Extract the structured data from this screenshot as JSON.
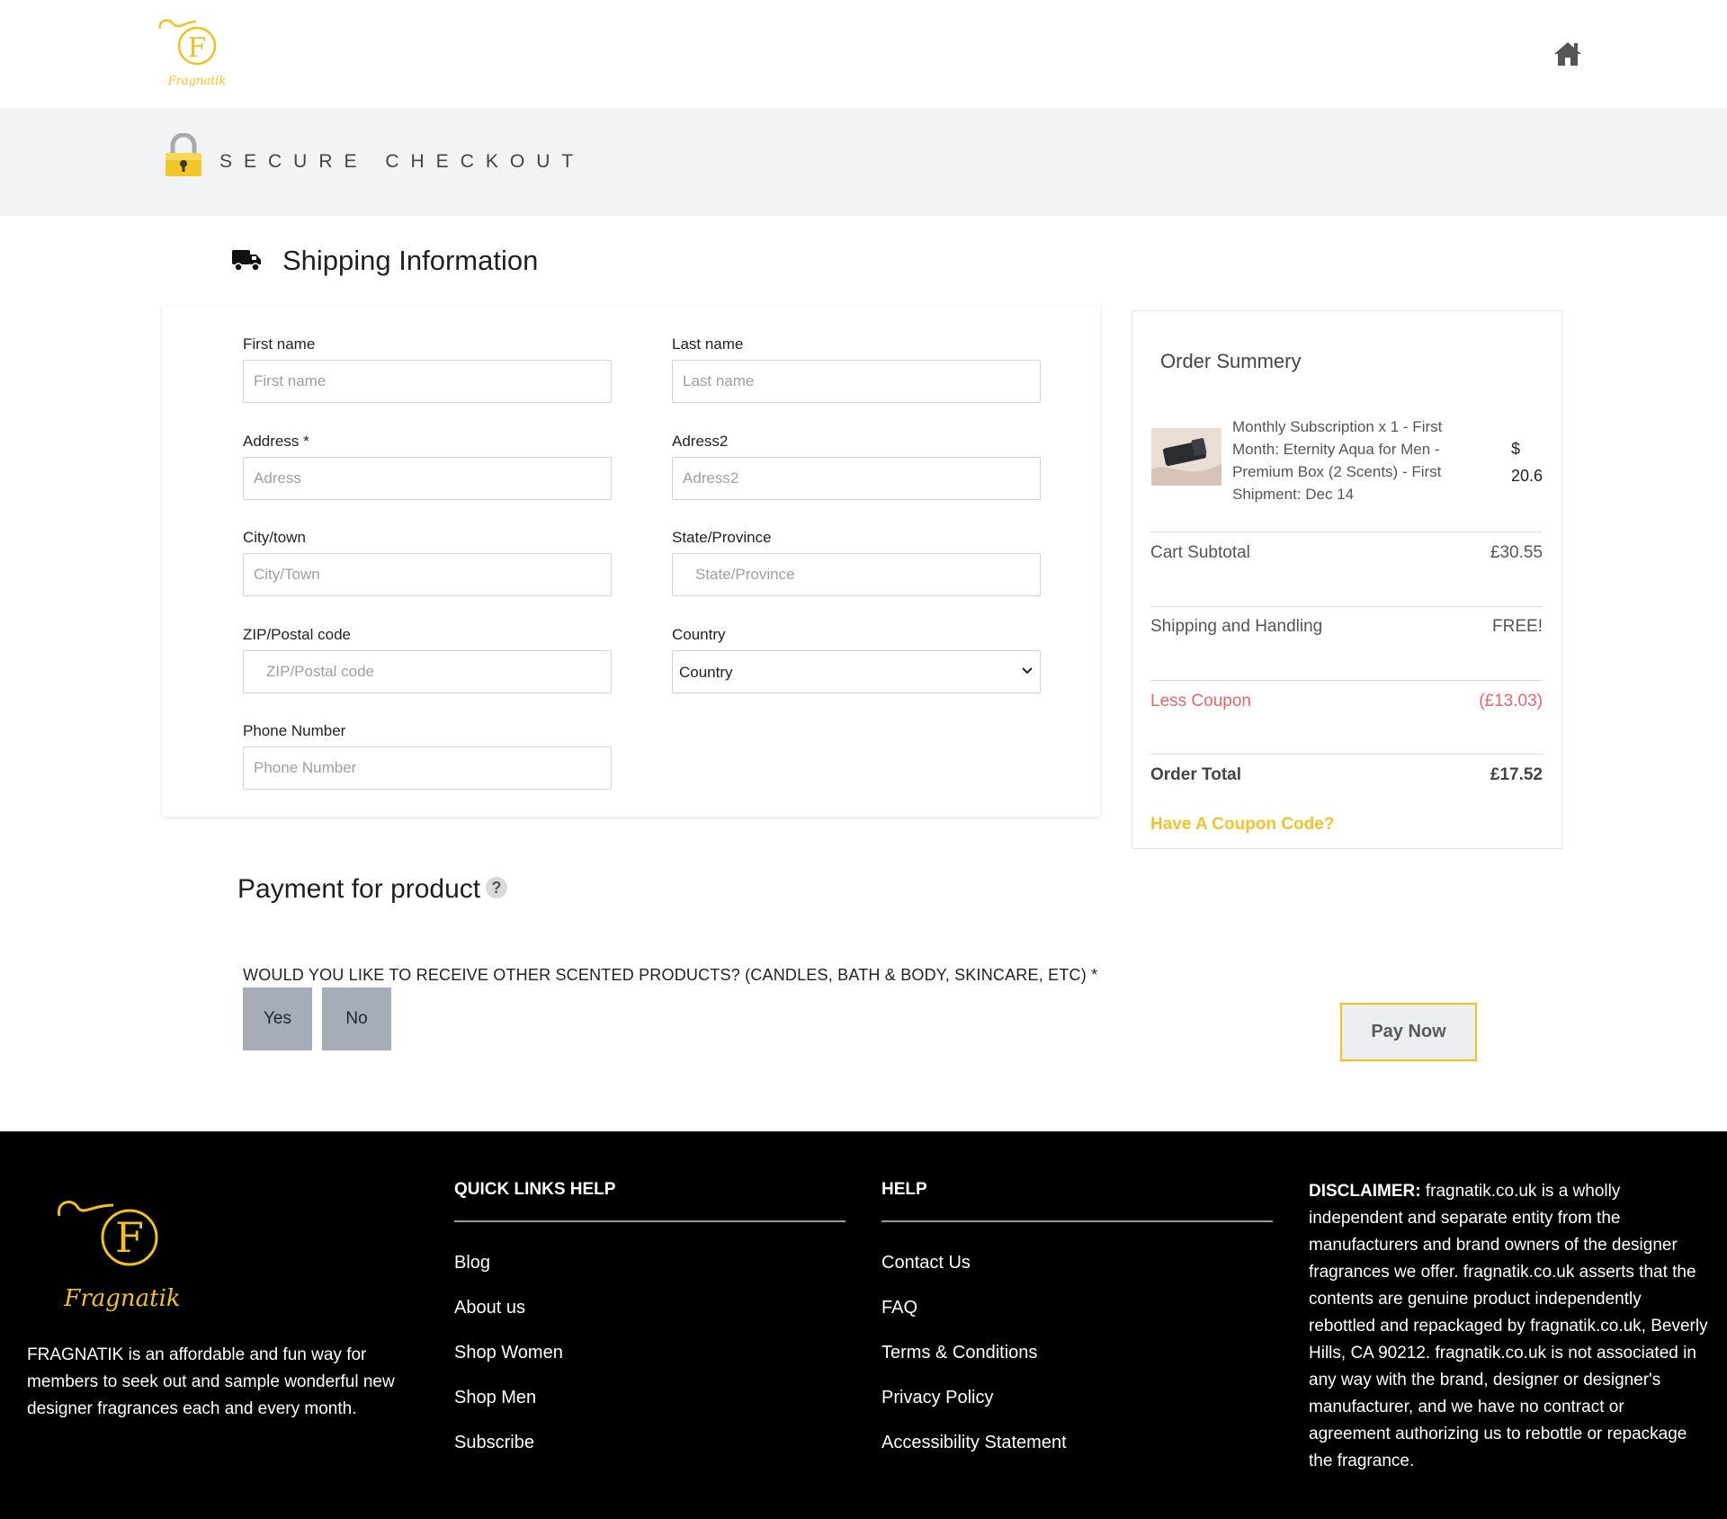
{
  "brand": {
    "logo_initial": "F",
    "logo_script": "Fragnatik",
    "gold": "#f1c21e"
  },
  "header": {
    "home_icon": "home-icon",
    "secure_checkout": "SECURE CHECKOUT"
  },
  "shipping": {
    "title": "Shipping Information",
    "fields": {
      "first_name": {
        "label": "First name",
        "placeholder": "First name"
      },
      "last_name": {
        "label": "Last name",
        "placeholder": "Last name"
      },
      "address": {
        "label": "Address *",
        "placeholder": "Adress"
      },
      "address2": {
        "label": "Adress2",
        "placeholder": "Adress2"
      },
      "city": {
        "label": "City/town",
        "placeholder": "City/Town"
      },
      "state": {
        "label": "State/Province",
        "placeholder": "State/Province"
      },
      "zip": {
        "label": "ZIP/Postal code",
        "placeholder": "ZIP/Postal code"
      },
      "country": {
        "label": "Country",
        "value": "Country"
      },
      "phone": {
        "label": "Phone Number",
        "placeholder": "Phone Number"
      }
    }
  },
  "summary": {
    "title": "Order Summery",
    "product": {
      "description": "Monthly Subscription x 1 - First Month: Eternity Aqua for Men - Premium Box (2 Scents) - First Shipment: Dec 14",
      "currency": "$",
      "price": "20.6"
    },
    "rows": {
      "subtotal": {
        "label": "Cart Subtotal",
        "value": "£30.55"
      },
      "shipping": {
        "label": "Shipping and Handling",
        "value": "FREE!"
      },
      "coupon": {
        "label": "Less Coupon",
        "value": "(£13.03)"
      },
      "total": {
        "label": "Order Total",
        "value": "£17.52"
      }
    },
    "coupon_link": "Have A Coupon Code?",
    "coupon_color": "#e8646a"
  },
  "payment": {
    "title": "Payment for product",
    "help_glyph": "?",
    "question": "WOULD YOU LIKE TO RECEIVE OTHER SCENTED PRODUCTS? (CANDLES, BATH & BODY, SKINCARE, ETC) *",
    "yes": "Yes",
    "no": "No",
    "pay_now": "Pay Now"
  },
  "footer": {
    "about": "FRAGNATIK is an affordable and fun way for members to seek out and sample wonderful new designer fragrances each and every month.",
    "quick_links": {
      "heading": "QUICK LINKS HELP",
      "items": [
        "Blog",
        "About us",
        "Shop Women",
        "Shop Men",
        "Subscribe"
      ]
    },
    "help": {
      "heading": "HELP",
      "items": [
        "Contact Us",
        "FAQ",
        "Terms & Conditions",
        "Privacy Policy",
        "Accessibility Statement"
      ]
    },
    "disclaimer_label": "DISCLAIMER:",
    "disclaimer_text": "fragnatik.co.uk is a wholly independent and separate entity from the manufacturers and brand owners of the designer fragrances we offer. fragnatik.co.uk asserts that the contents are genuine product independently rebottled and repackaged by fragnatik.co.uk, Beverly Hills, CA 90212. fragnatik.co.uk is not associated in any way with the brand, designer or designer's manufacturer, and we have no contract or agreement authorizing us to rebottle or repackage the fragrance."
  }
}
